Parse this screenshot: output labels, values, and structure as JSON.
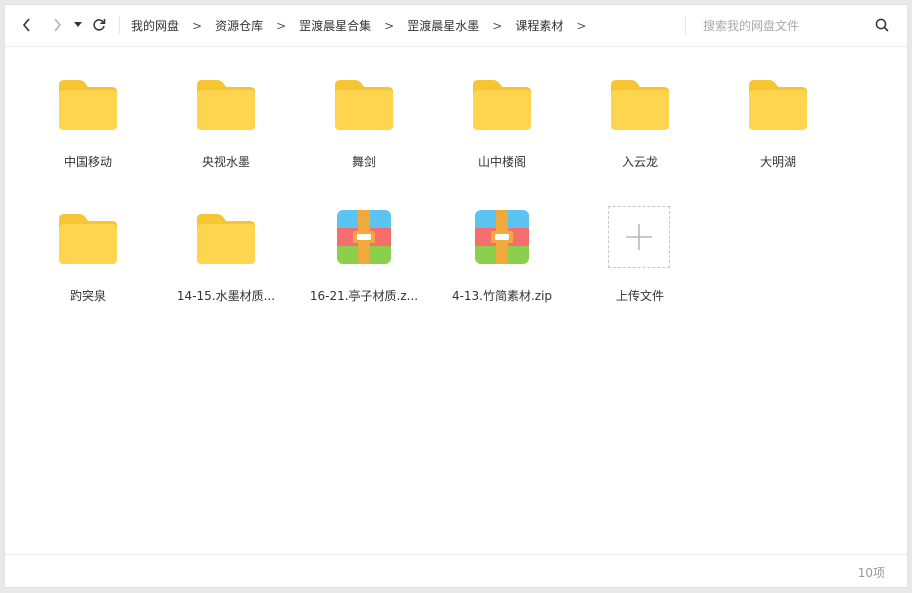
{
  "nav": {
    "back_icon": "chevron-left-icon",
    "forward_icon": "chevron-right-icon",
    "history_icon": "caret-down-icon",
    "refresh_icon": "refresh-icon"
  },
  "breadcrumb": {
    "items": [
      "我的网盘",
      "资源仓库",
      "罡渡晨星合集",
      "罡渡晨星水墨",
      "课程素材"
    ],
    "separator": ">"
  },
  "search": {
    "placeholder": "搜索我的网盘文件",
    "icon": "search-icon"
  },
  "files": [
    {
      "name": "中国移动",
      "type": "folder"
    },
    {
      "name": "央视水墨",
      "type": "folder"
    },
    {
      "name": "舞剑",
      "type": "folder"
    },
    {
      "name": "山中楼阁",
      "type": "folder"
    },
    {
      "name": "入云龙",
      "type": "folder"
    },
    {
      "name": "大明湖",
      "type": "folder"
    },
    {
      "name": "趵突泉",
      "type": "folder"
    },
    {
      "name": "14-15.水墨材质...",
      "type": "folder"
    },
    {
      "name": "16-21.亭子材质.z...",
      "type": "zip"
    },
    {
      "name": "4-13.竹简素材.zip",
      "type": "zip"
    }
  ],
  "upload": {
    "label": "上传文件",
    "icon": "plus-icon"
  },
  "footer": {
    "count": "10项"
  },
  "colors": {
    "folder": "#ffd54f",
    "folder_tab": "#f5c533",
    "zip_blue": "#5bc4f1",
    "zip_red": "#f56d6d",
    "zip_green": "#8ccf4d",
    "zip_strap": "#f2a93b"
  }
}
